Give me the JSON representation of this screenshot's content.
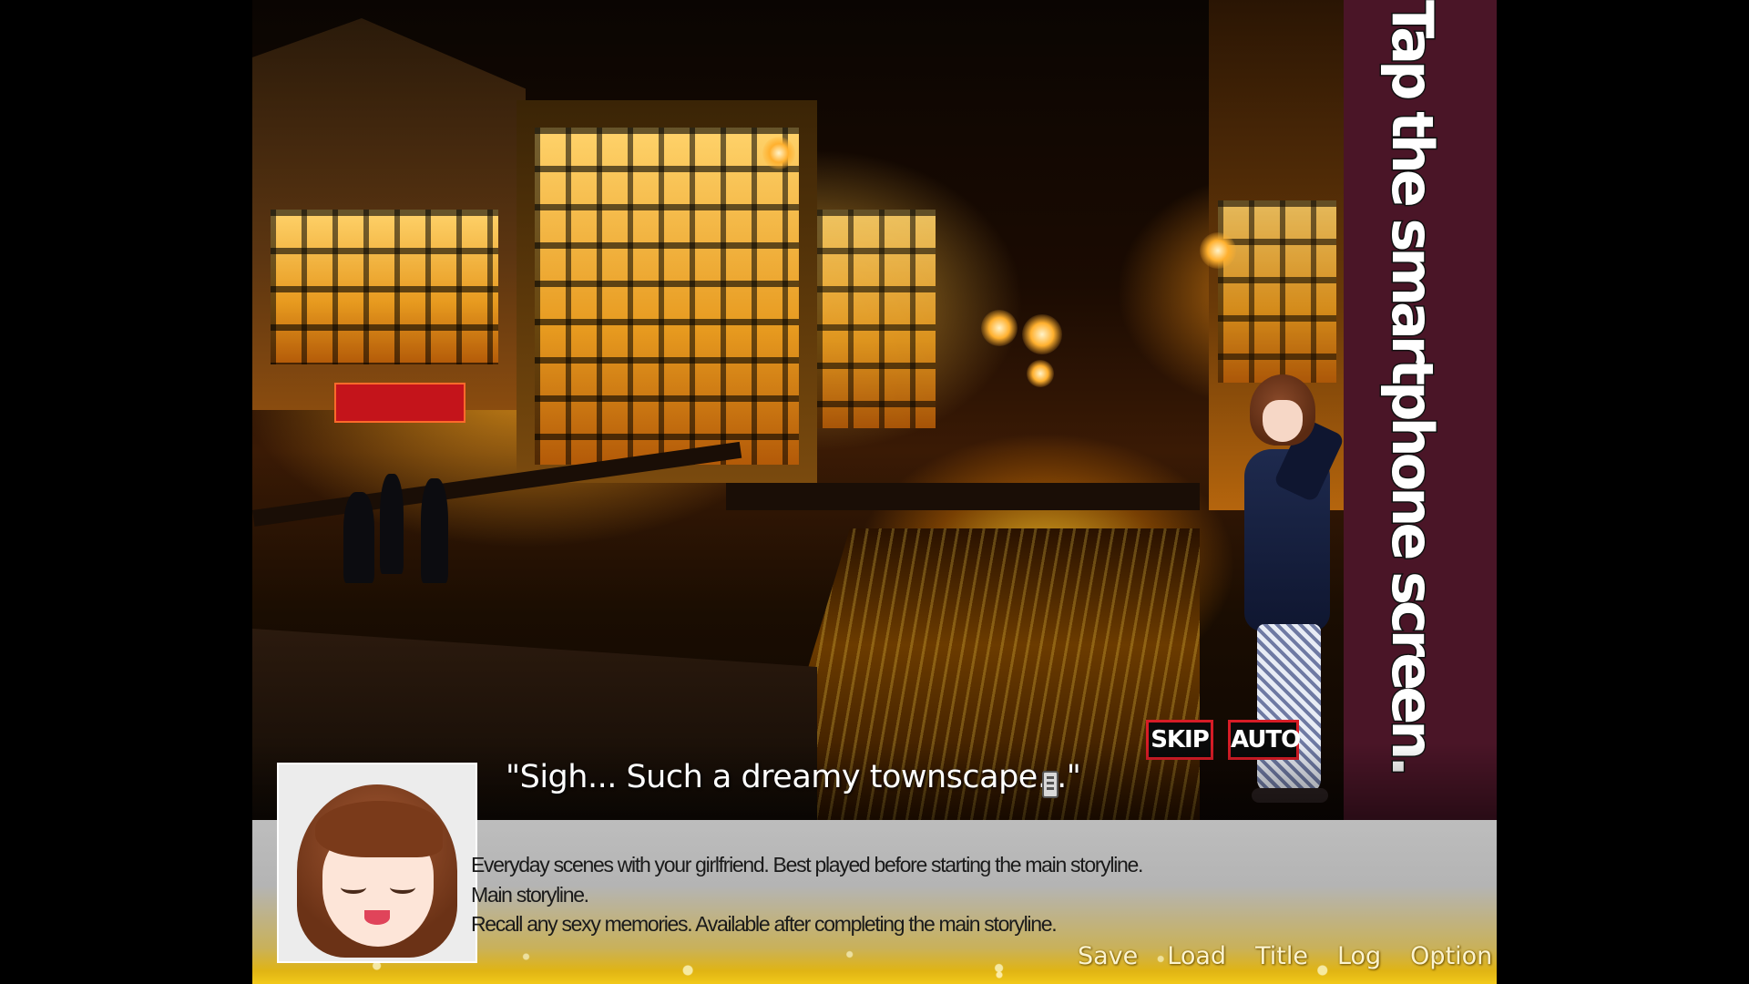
{
  "side_banner": {
    "text": "Tap the smartphone screen."
  },
  "quick_controls": {
    "skip_label": "SKIP",
    "auto_label": "AUTO"
  },
  "dialogue": {
    "line": "\"Sigh... Such a dreamy townscape...\"",
    "next_icon": "smartphone-icon"
  },
  "descriptions": [
    "Everyday scenes with your girlfriend. Best played before starting the main storyline.",
    "Main storyline.",
    "Recall any sexy memories. Available after completing the main storyline."
  ],
  "menu": [
    {
      "label": "Save"
    },
    {
      "label": "Load"
    },
    {
      "label": "Title"
    },
    {
      "label": "Log"
    },
    {
      "label": "Option"
    }
  ],
  "colors": {
    "banner_bg": "#4a1527",
    "button_border": "#d71c26",
    "panel_gold": "#f2c91a"
  }
}
